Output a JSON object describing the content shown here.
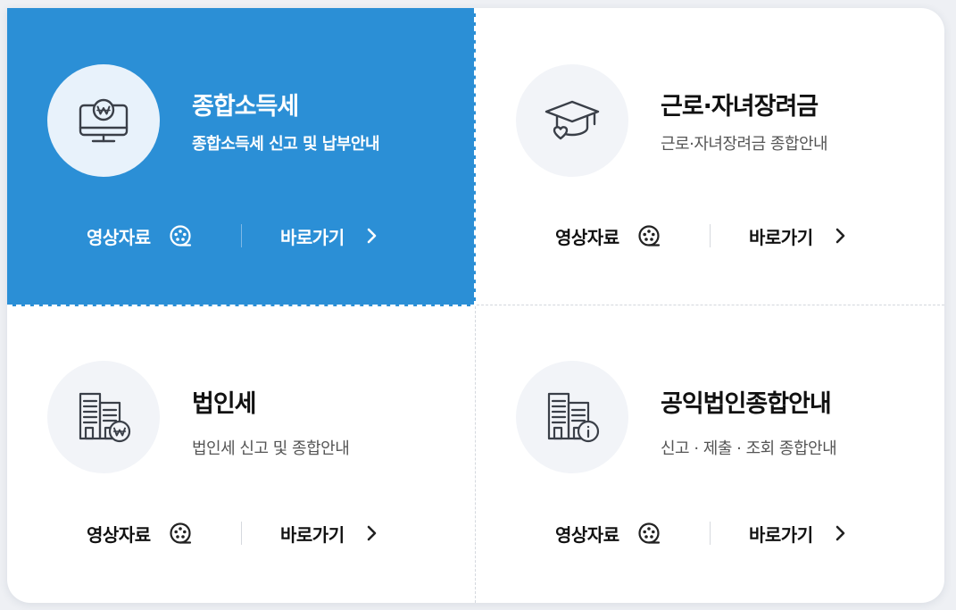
{
  "cards": [
    {
      "title": "종합소득세",
      "subtitle": "종합소득세 신고 및 납부안내",
      "icon": "monitor-won-icon",
      "video_label": "영상자료",
      "goto_label": "바로가기",
      "active": true
    },
    {
      "title": "근로·자녀장려금",
      "subtitle": "근로·자녀장려금 종합안내",
      "icon": "graduation-cap-heart-icon",
      "video_label": "영상자료",
      "goto_label": "바로가기",
      "active": false
    },
    {
      "title": "법인세",
      "subtitle": "법인세 신고 및 종합안내",
      "icon": "building-won-icon",
      "video_label": "영상자료",
      "goto_label": "바로가기",
      "active": false
    },
    {
      "title": "공익법인종합안내",
      "subtitle": "신고 · 제출 · 조회 종합안내",
      "icon": "building-info-icon",
      "video_label": "영상자료",
      "goto_label": "바로가기",
      "active": false
    }
  ],
  "colors": {
    "active_bg": "#2b8fd6",
    "icon_bg": "#f2f4f8",
    "text": "#111111",
    "subtext": "#555555"
  }
}
